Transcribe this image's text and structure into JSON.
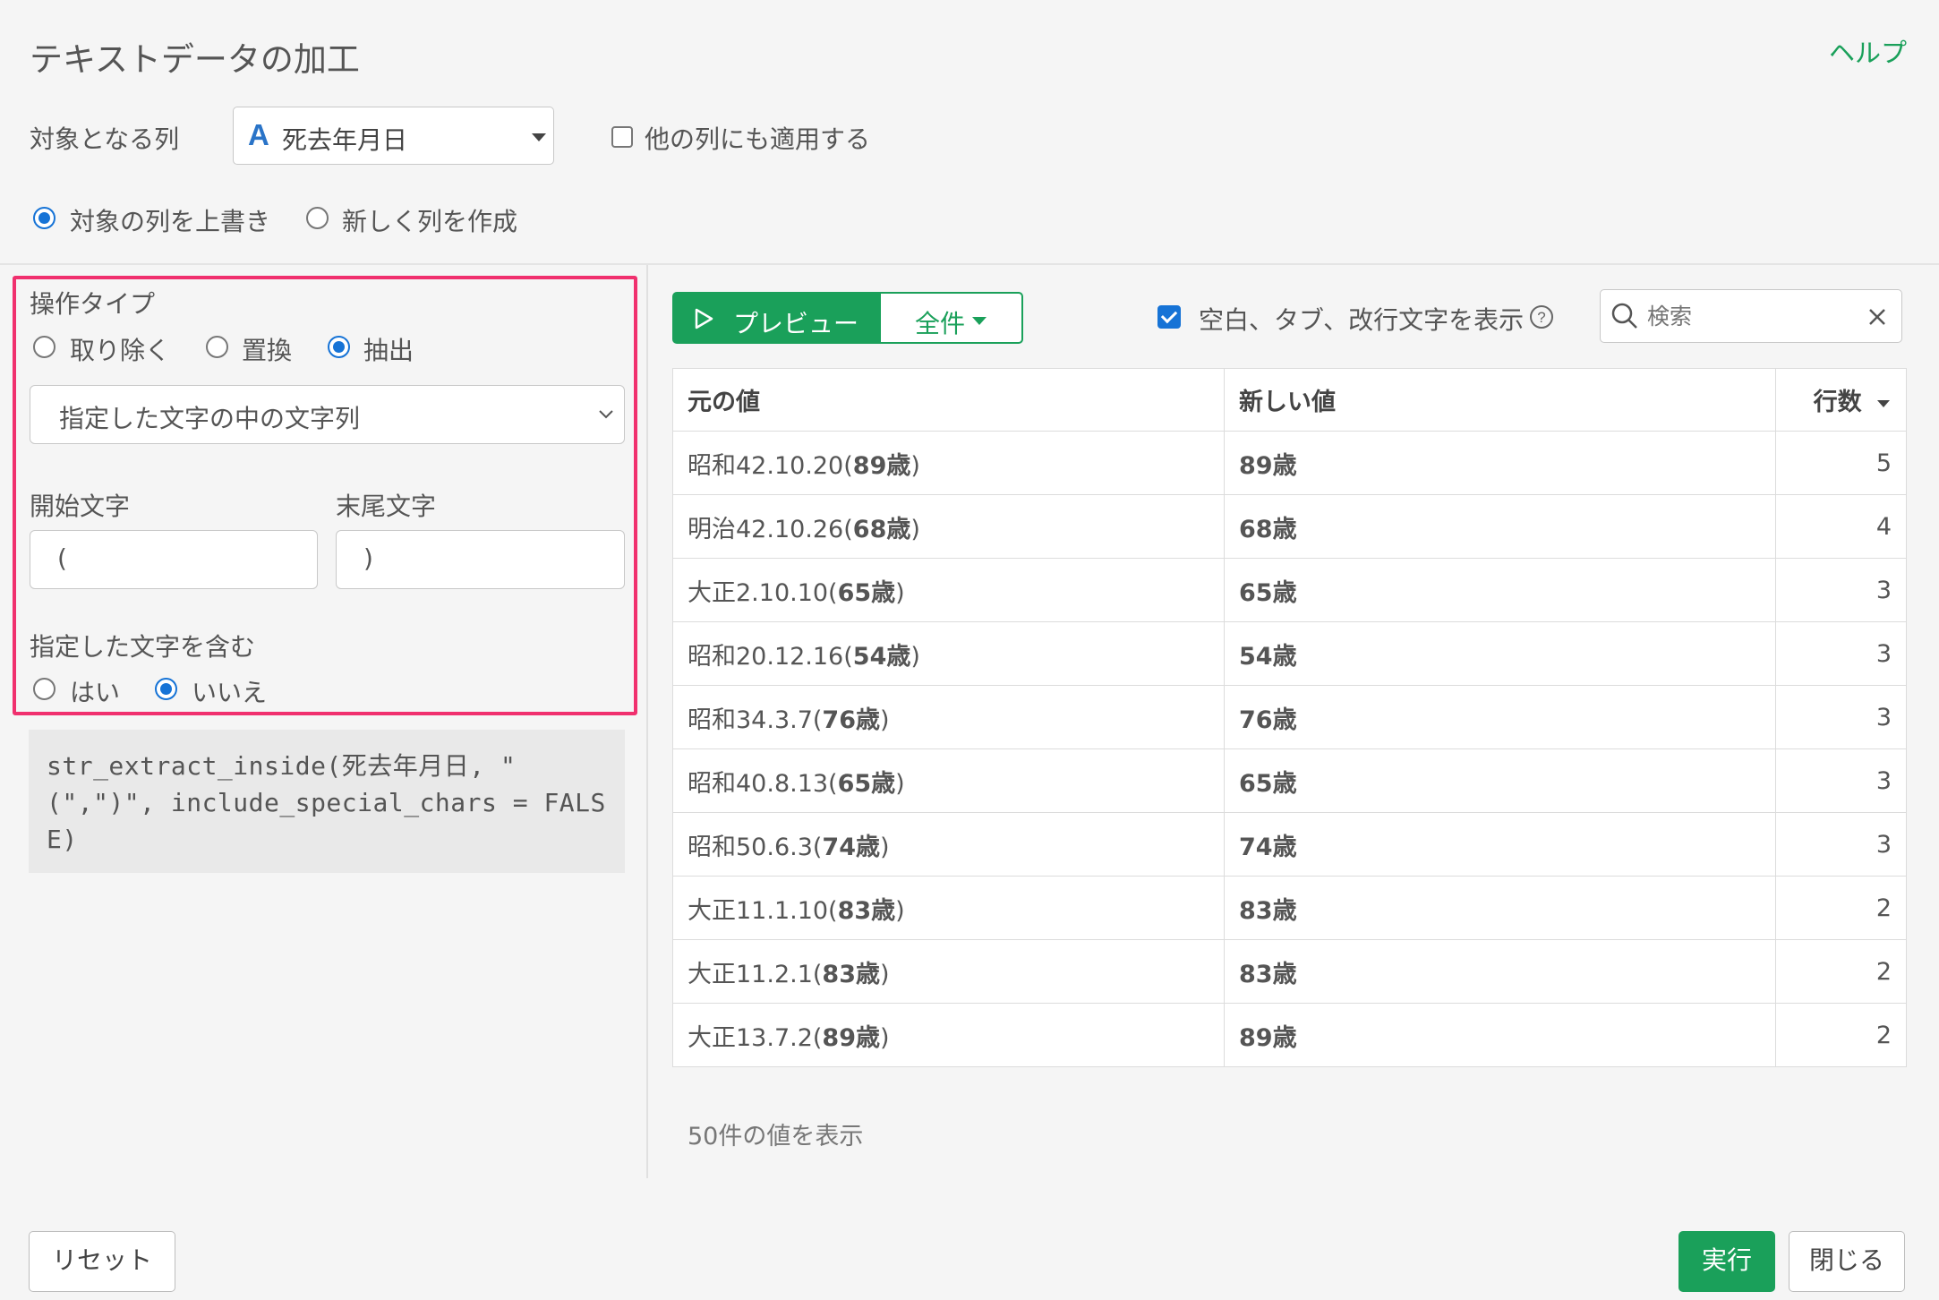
{
  "header": {
    "title": "テキストデータの加工",
    "help": "ヘルプ"
  },
  "target": {
    "label": "対象となる列",
    "column": "死去年月日",
    "apply_other_label": "他の列にも適用する",
    "apply_other_checked": false
  },
  "output_mode": {
    "options": [
      "対象の列を上書き",
      "新しく列を作成"
    ],
    "selected": "対象の列を上書き"
  },
  "operation": {
    "label": "操作タイプ",
    "options": [
      "取り除く",
      "置換",
      "抽出"
    ],
    "selected": "抽出",
    "method": "指定した文字の中の文字列",
    "start_label": "開始文字",
    "start_value": "(",
    "end_label": "末尾文字",
    "end_value": ")",
    "include_label": "指定した文字を含む",
    "include_options": [
      "はい",
      "いいえ"
    ],
    "include_selected": "いいえ"
  },
  "code": "str_extract_inside(死去年月日, \"(\",\")\", include_special_chars = FALSE)",
  "preview": {
    "preview_button": "プレビュー",
    "filter_button": "全件",
    "show_whitespace_label": "空白、タブ、改行文字を表示",
    "show_whitespace_checked": true,
    "search_placeholder": "検索",
    "columns": [
      "元の値",
      "新しい値",
      "行数"
    ],
    "rows": [
      {
        "orig_pre": "昭和42.10.20(",
        "orig_bold": "89歳",
        "orig_post": ")",
        "new": "89歳",
        "count": "5"
      },
      {
        "orig_pre": "明治42.10.26(",
        "orig_bold": "68歳",
        "orig_post": ")",
        "new": "68歳",
        "count": "4"
      },
      {
        "orig_pre": "大正2.10.10(",
        "orig_bold": "65歳",
        "orig_post": ")",
        "new": "65歳",
        "count": "3"
      },
      {
        "orig_pre": "昭和20.12.16(",
        "orig_bold": "54歳",
        "orig_post": ")",
        "new": "54歳",
        "count": "3"
      },
      {
        "orig_pre": "昭和34.3.7(",
        "orig_bold": "76歳",
        "orig_post": ")",
        "new": "76歳",
        "count": "3"
      },
      {
        "orig_pre": "昭和40.8.13(",
        "orig_bold": "65歳",
        "orig_post": ")",
        "new": "65歳",
        "count": "3"
      },
      {
        "orig_pre": "昭和50.6.3(",
        "orig_bold": "74歳",
        "orig_post": ")",
        "new": "74歳",
        "count": "3"
      },
      {
        "orig_pre": "大正11.1.10(",
        "orig_bold": "83歳",
        "orig_post": ")",
        "new": "83歳",
        "count": "2"
      },
      {
        "orig_pre": "大正11.2.1(",
        "orig_bold": "83歳",
        "orig_post": ")",
        "new": "83歳",
        "count": "2"
      },
      {
        "orig_pre": "大正13.7.2(",
        "orig_bold": "89歳",
        "orig_post": ")",
        "new": "89歳",
        "count": "2"
      }
    ],
    "footer": "50件の値を表示"
  },
  "footer": {
    "reset": "リセット",
    "run": "実行",
    "close": "閉じる"
  },
  "colors": {
    "accent": "#1aa05a",
    "highlight_border": "#f0306e",
    "radio_blue": "#1673d6"
  }
}
